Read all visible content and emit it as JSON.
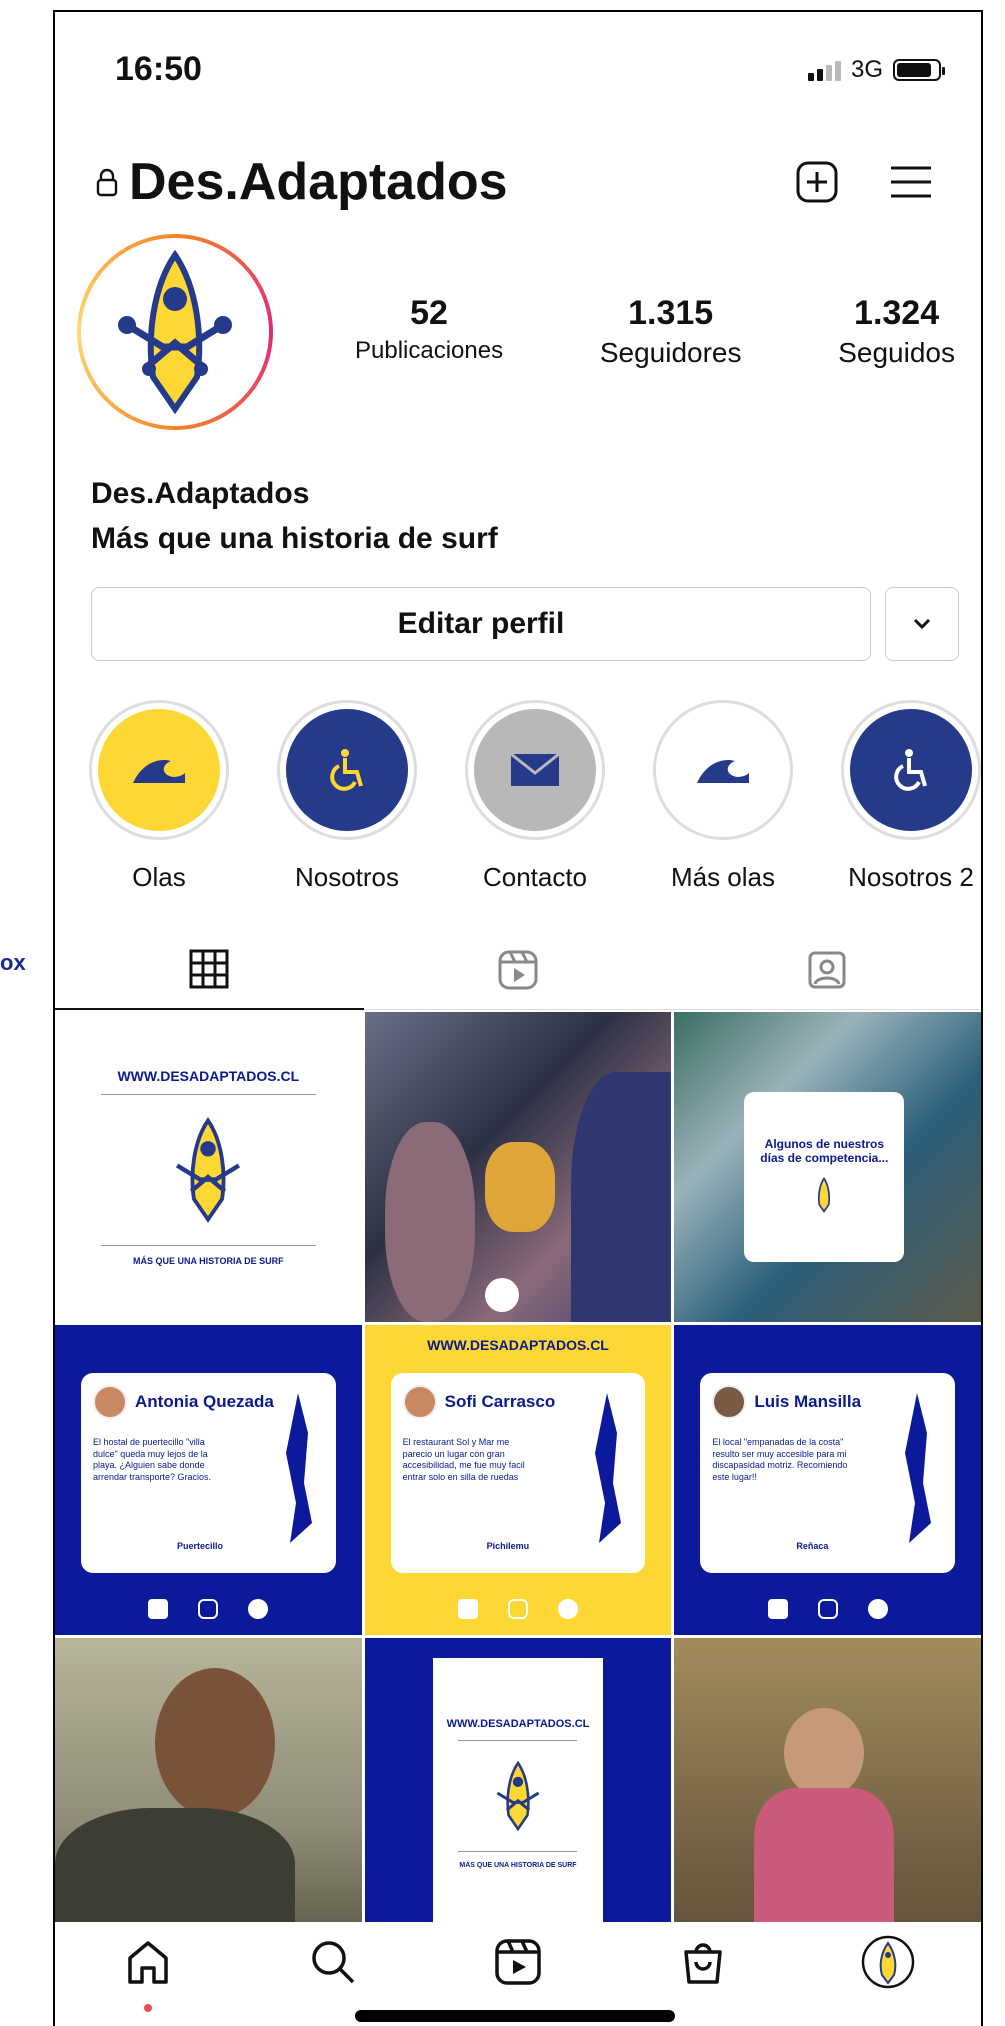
{
  "side_note": "ox",
  "status": {
    "time": "16:50",
    "network": "3G"
  },
  "header": {
    "username": "Des.Adaptados"
  },
  "stats": [
    {
      "num": "52",
      "label": "Publicaciones"
    },
    {
      "num": "1.315",
      "label": "Seguidores"
    },
    {
      "num": "1.324",
      "label": "Seguidos"
    }
  ],
  "bio": {
    "name": "Des.Adaptados",
    "text": "Más que una historia de surf"
  },
  "edit_profile": "Editar perfil",
  "highlights": [
    {
      "label": "Olas",
      "color": "#fdd835",
      "icon": "wave-icon"
    },
    {
      "label": "Nosotros",
      "color": "#263a8a",
      "icon": "wheelchair-icon"
    },
    {
      "label": "Contacto",
      "color": "#b8b8b8",
      "icon": "mail-icon"
    },
    {
      "label": "Más olas",
      "color": "#ffffff",
      "icon": "wave-icon"
    },
    {
      "label": "Nosotros 2",
      "color": "#263a8a",
      "icon": "wheelchair-icon"
    }
  ],
  "posts": {
    "logo_url": "WWW.DESADAPTADOS.CL",
    "logo_slogan": "MÁS QUE UNA HISTORIA DE SURF",
    "competencia": "Algunos de nuestros días de competencia...",
    "reviews": [
      {
        "name": "Antonia Quezada",
        "text": "El hostal de puertecillo \"villa dulce\" queda muy lejos de la playa. ¿Alguien sabe donde arrendar transporte? Gracios.",
        "place": "Puertecillo",
        "bg": "#0a1a9b"
      },
      {
        "name": "Sofi Carrasco",
        "text": "El restaurant Sol y Mar me parecio un lugar con gran accesibilidad, me fue muy facil entrar solo en silla de ruedas",
        "place": "Pichilemu",
        "bg": "#fdd835"
      },
      {
        "name": "Luis Mansilla",
        "text": "El local \"empanadas de la costa\" resulto ser muy accesible para mi discapasidad motriz. Recomiendo este lugar!!",
        "place": "Reñaca",
        "bg": "#0a1a9b"
      }
    ]
  },
  "colors": {
    "brand_blue": "#0a1a9b",
    "brand_yellow": "#fdd835",
    "notification": "#ed4956"
  }
}
